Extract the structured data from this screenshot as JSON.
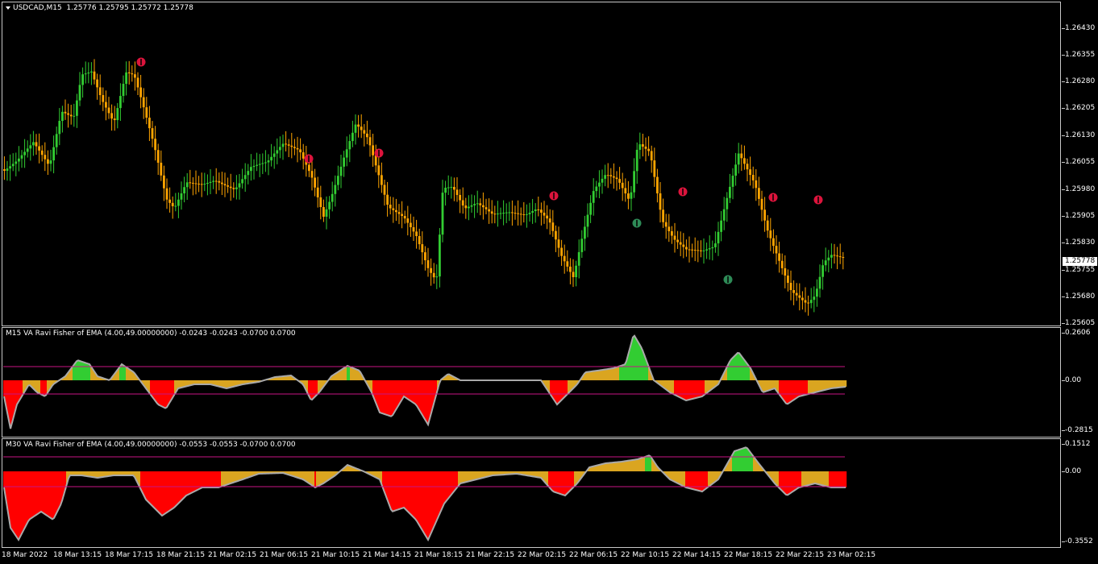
{
  "main": {
    "symbol": "USDCAD,M15",
    "ohlc": "1.25776 1.25795 1.25772 1.25778",
    "price_labels": [
      "1.26430",
      "1.26355",
      "1.26280",
      "1.26205",
      "1.26130",
      "1.26055",
      "1.25980",
      "1.25905",
      "1.25830",
      "1.25755",
      "1.25680",
      "1.25605"
    ],
    "current_price": "1.25778"
  },
  "ind1": {
    "title": "M15 VA Ravi Fisher of EMA  (4.00,49.00000000) -0.0243 -0.0243 -0.0700 0.0700",
    "labels": [
      "0.2606",
      "0.00",
      "-0.2815"
    ]
  },
  "ind2": {
    "title": "M30 VA Ravi Fisher of EMA  (4.00,49.00000000) -0.0553 -0.0553 -0.0700 0.0700",
    "labels": [
      "0.1512",
      "0.00",
      "-0.3552"
    ]
  },
  "time_labels": [
    "18 Mar 2022",
    "18 Mar 13:15",
    "18 Mar 17:15",
    "18 Mar 21:15",
    "21 Mar 02:15",
    "21 Mar 06:15",
    "21 Mar 10:15",
    "21 Mar 14:15",
    "21 Mar 18:15",
    "21 Mar 22:15",
    "22 Mar 02:15",
    "22 Mar 06:15",
    "22 Mar 10:15",
    "22 Mar 14:15",
    "22 Mar 18:15",
    "22 Mar 22:15",
    "23 Mar 02:15"
  ],
  "colors": {
    "bull": "#32cd32",
    "bear": "#ffa500",
    "hist_red": "#ff0000",
    "hist_gold": "#daa520",
    "hist_green": "#32cd32",
    "line": "#a9a9a9",
    "level": "#c71585",
    "arrow_sell": "#dc143c",
    "arrow_buy": "#2e8b57"
  }
}
